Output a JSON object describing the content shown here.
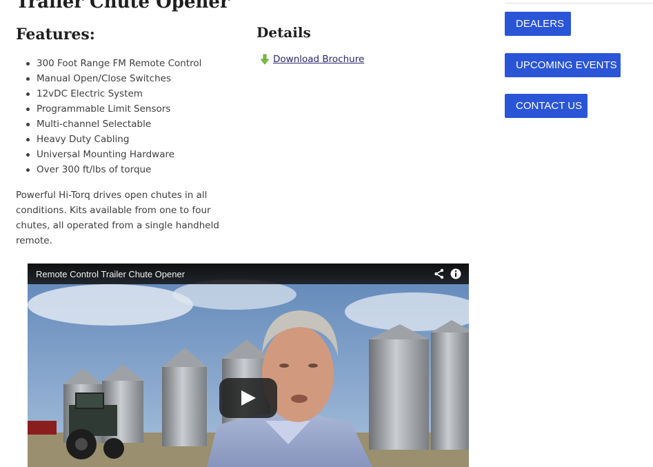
{
  "product": {
    "title": "Trailer Chute Opener"
  },
  "features": {
    "heading": "Features:",
    "items": [
      "300 Foot Range FM Remote Control",
      "Manual Open/Close Switches",
      "12vDC Electric System",
      "Programmable Limit Sensors",
      "Multi-channel Selectable",
      "Heavy Duty Cabling",
      "Universal Mounting Hardware",
      "Over 300 ft/lbs of torque"
    ],
    "description": "Powerful Hi-Torq drives open chutes in all conditions. Kits available from one to four chutes, all operated from a single handheld remote."
  },
  "details": {
    "heading": "Details",
    "brochure_link": "Download Brochure",
    "brochure_icon": "download-arrow-icon"
  },
  "sidebar": {
    "buttons": [
      {
        "label": "DEALERS"
      },
      {
        "label": "UPCOMING EVENTS"
      },
      {
        "label": "CONTACT US"
      }
    ],
    "button_color": "#2a55d6"
  },
  "video": {
    "title": "Remote Control Trailer Chute Opener",
    "icons": [
      "share-icon",
      "info-icon",
      "play-icon"
    ]
  }
}
